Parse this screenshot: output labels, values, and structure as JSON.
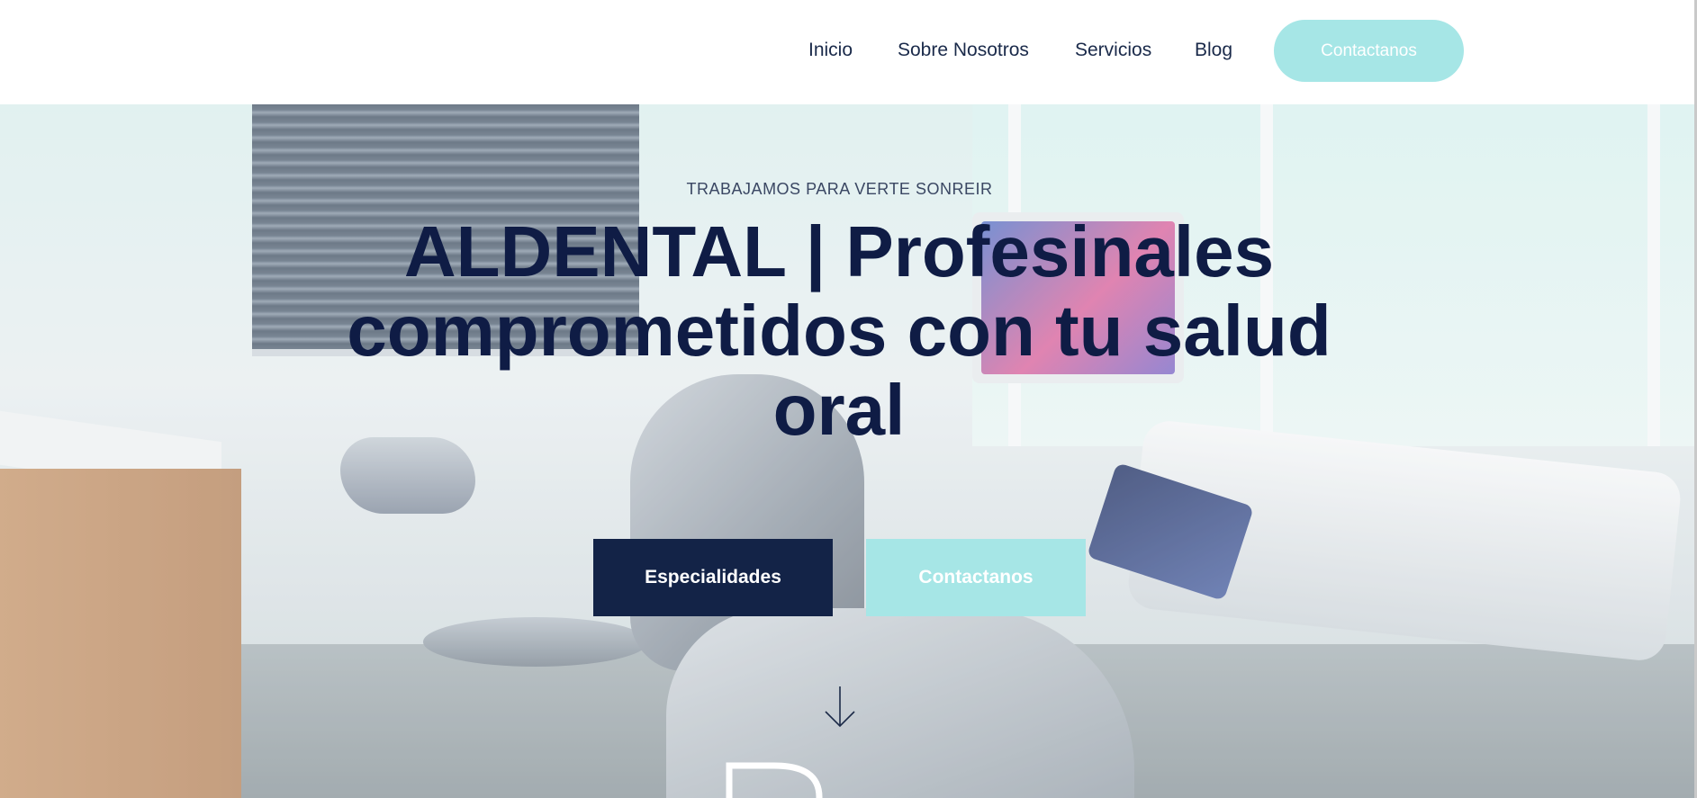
{
  "nav": {
    "links": [
      {
        "label": "Inicio"
      },
      {
        "label": "Sobre Nosotros"
      },
      {
        "label": "Servicios"
      },
      {
        "label": "Blog"
      }
    ],
    "cta_label": "Contactanos"
  },
  "hero": {
    "eyebrow": "TRABAJAMOS PARA VERTE SONREIR",
    "headline": "ALDENTAL | Profesinales comprometidos con tu salud oral",
    "primary_button": "Especialidades",
    "secondary_button": "Contactanos",
    "scroll_icon": "arrow-down-icon"
  },
  "colors": {
    "accent": "#a6e6e6",
    "navy": "#132347",
    "headline": "#0f1c45",
    "nav_text": "#1a2a4a"
  }
}
